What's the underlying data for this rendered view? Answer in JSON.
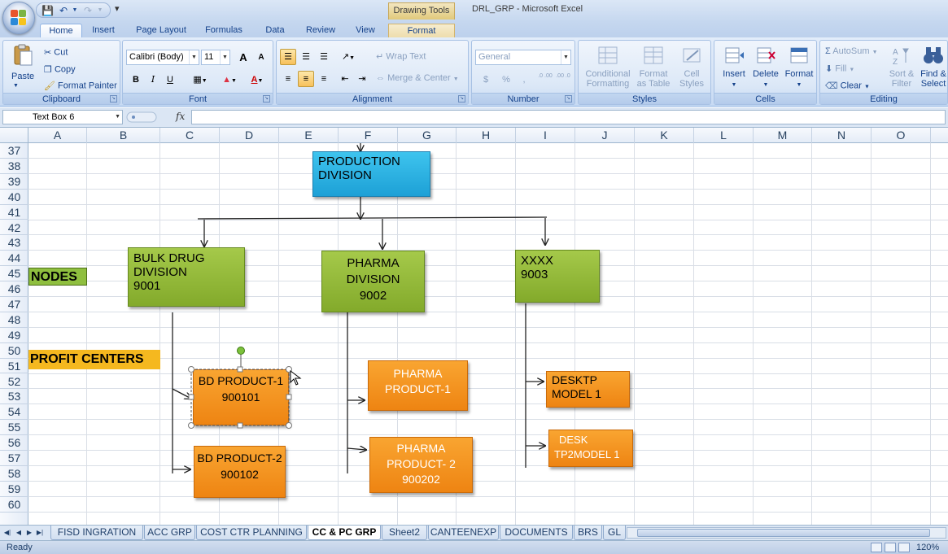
{
  "window": {
    "context_tab": "Drawing Tools",
    "title": "DRL_GRP - Microsoft Excel"
  },
  "tabs": [
    {
      "label": "Home",
      "active": true
    },
    {
      "label": "Insert"
    },
    {
      "label": "Page Layout"
    },
    {
      "label": "Formulas"
    },
    {
      "label": "Data"
    },
    {
      "label": "Review"
    },
    {
      "label": "View"
    },
    {
      "label": "Format",
      "contextual": true
    }
  ],
  "ribbon": {
    "clipboard": {
      "label": "Clipboard",
      "paste": "Paste",
      "cut": "Cut",
      "copy": "Copy",
      "format_painter": "Format Painter"
    },
    "font": {
      "label": "Font",
      "name": "Calibri (Body)",
      "size": "11",
      "bold": "B",
      "italic": "I",
      "underline": "U",
      "grow": "A",
      "shrink": "A"
    },
    "alignment": {
      "label": "Alignment",
      "wrap_text": "Wrap Text",
      "merge_center": "Merge & Center"
    },
    "number": {
      "label": "Number",
      "format": "General",
      "currency": "$",
      "percent": "%",
      "comma": ",",
      "inc_dec": ".0 .00",
      "dec_dec": ".00 .0"
    },
    "styles": {
      "label": "Styles",
      "conditional": "Conditional",
      "conditional2": "Formatting",
      "format_as": "Format",
      "format_as2": "as Table",
      "cell": "Cell",
      "cell2": "Styles"
    },
    "cells": {
      "label": "Cells",
      "insert": "Insert",
      "delete": "Delete",
      "format": "Format"
    },
    "editing": {
      "label": "Editing",
      "autosum": "AutoSum",
      "fill": "Fill",
      "clear": "Clear",
      "sort": "Sort &",
      "sort2": "Filter",
      "find": "Find &",
      "find2": "Select"
    }
  },
  "formula_bar": {
    "name_box": "Text Box 6",
    "fx": "fx",
    "value": ""
  },
  "columns": [
    "A",
    "B",
    "C",
    "D",
    "E",
    "F",
    "G",
    "H",
    "I",
    "J",
    "K",
    "L",
    "M",
    "N",
    "O"
  ],
  "rows": [
    "37",
    "38",
    "39",
    "40",
    "41",
    "42",
    "43",
    "44",
    "45",
    "46",
    "47",
    "48",
    "49",
    "50",
    "51",
    "52",
    "53",
    "54",
    "55",
    "56",
    "57",
    "58",
    "59",
    "60"
  ],
  "cells": {
    "nodes": "NODES",
    "profit_centers": "PROFIT CENTERS"
  },
  "shapes": {
    "production": {
      "line1": "PRODUCTION",
      "line2": "DIVISION"
    },
    "bulk": {
      "line1": "BULK DRUG",
      "line2": "DIVISION",
      "line3": "9001"
    },
    "pharma": {
      "line1": "PHARMA",
      "line2": "DIVISION",
      "line3": "9002"
    },
    "xxxx": {
      "line1": "XXXX",
      "line2": "9003"
    },
    "bd1": {
      "line1": "BD PRODUCT-1",
      "line2": "900101"
    },
    "bd2": {
      "line1": "BD PRODUCT-2",
      "line2": "900102"
    },
    "ph1": {
      "line1": "PHARMA",
      "line2": "PRODUCT-1"
    },
    "ph2": {
      "line1": "PHARMA",
      "line2": "PRODUCT-  2",
      "line3": "900202"
    },
    "desk1": {
      "line1": "DESKTP",
      "line2": "MODEL 1"
    },
    "desk2": {
      "line1": "DESK",
      "line2": "TP2MODEL 1"
    }
  },
  "sheet_tabs": [
    {
      "label": "FISD INGRATION"
    },
    {
      "label": "ACC GRP"
    },
    {
      "label": "COST CTR PLANNING"
    },
    {
      "label": "CC & PC GRP",
      "active": true
    },
    {
      "label": "Sheet2"
    },
    {
      "label": "CANTEENEXP"
    },
    {
      "label": "DOCUMENTS"
    },
    {
      "label": "BRS"
    },
    {
      "label": "GL"
    }
  ],
  "status": {
    "text": "Ready",
    "zoom": "120%"
  },
  "colors": {
    "blue_shape": "#1da0d6",
    "green_shape": "#83aa2b",
    "orange_shape": "#ee8412",
    "nodes_fill": "#8fbf3f",
    "profit_fill": "#f5b81f"
  }
}
